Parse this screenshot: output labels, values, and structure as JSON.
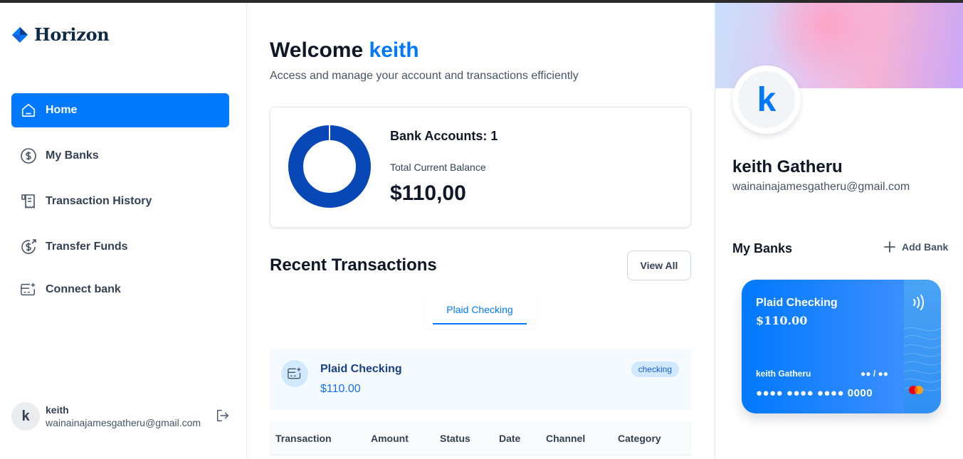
{
  "app": {
    "name": "Horizon"
  },
  "sidebar": {
    "items": [
      {
        "label": "Home",
        "icon": "home-icon",
        "active": true
      },
      {
        "label": "My Banks",
        "icon": "dollar-circle-icon",
        "active": false
      },
      {
        "label": "Transaction History",
        "icon": "receipt-icon",
        "active": false
      },
      {
        "label": "Transfer Funds",
        "icon": "money-send-icon",
        "active": false
      },
      {
        "label": "Connect bank",
        "icon": "card-add-icon",
        "active": false
      }
    ],
    "user": {
      "initial": "k",
      "name": "keith",
      "email": "wainainajamesgatheru@gmail.com"
    }
  },
  "header": {
    "welcome": "Welcome",
    "user_name": "keith",
    "subtext": "Access and manage your account and transactions efficiently"
  },
  "balance": {
    "bank_accounts_label": "Bank Accounts: 1",
    "total_label": "Total Current Balance",
    "total_value": "$110,00",
    "donut_color": "#0747b6"
  },
  "recent": {
    "title": "Recent Transactions",
    "view_all": "View All",
    "tab": "Plaid Checking",
    "account": {
      "name": "Plaid Checking",
      "amount": "$110.00",
      "type": "checking"
    },
    "columns": [
      "Transaction",
      "Amount",
      "Status",
      "Date",
      "Channel",
      "Category"
    ]
  },
  "profile": {
    "initial": "k",
    "name": "keith Gatheru",
    "email": "wainainajamesgatheru@gmail.com"
  },
  "banks": {
    "title": "My Banks",
    "add_label": "Add Bank",
    "card": {
      "name": "Plaid Checking",
      "balance": "$110.00",
      "holder": "keith Gatheru",
      "expiry": "●● / ●●",
      "number": "●●●● ●●●● ●●●● 0000"
    }
  },
  "colors": {
    "accent": "#0179fe",
    "text": "#101828",
    "muted": "#475467"
  }
}
